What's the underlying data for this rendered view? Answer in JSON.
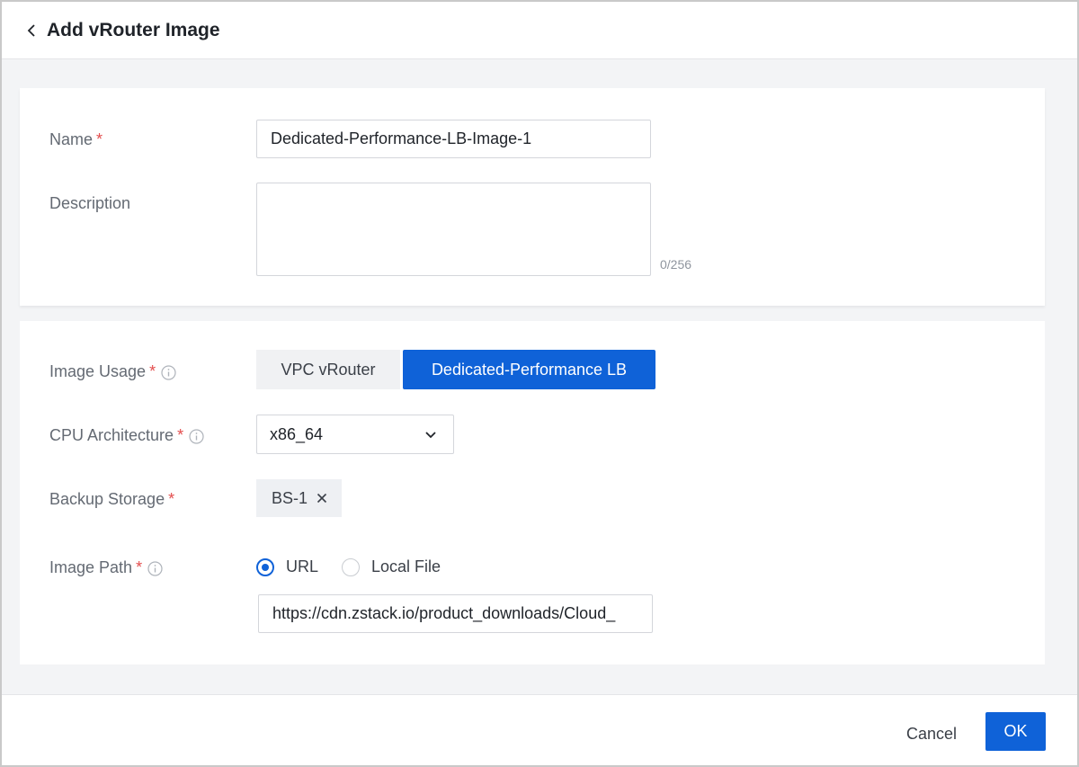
{
  "header": {
    "title": "Add vRouter Image",
    "back_icon": "chevron-left-icon"
  },
  "form": {
    "name": {
      "label": "Name",
      "required_mark": "*",
      "value": "Dedicated-Performance-LB-Image-1"
    },
    "description": {
      "label": "Description",
      "value": "",
      "counter": "0/256"
    },
    "image_usage": {
      "label": "Image Usage",
      "required_mark": "*",
      "options": [
        "VPC vRouter",
        "Dedicated-Performance LB"
      ],
      "selected": "Dedicated-Performance LB"
    },
    "cpu_architecture": {
      "label": "CPU Architecture",
      "required_mark": "*",
      "value": "x86_64"
    },
    "backup_storage": {
      "label": "Backup Storage",
      "required_mark": "*",
      "tag": "BS-1"
    },
    "image_path": {
      "label": "Image Path",
      "required_mark": "*",
      "options": [
        "URL",
        "Local File"
      ],
      "selected": "URL",
      "url_value": "https://cdn.zstack.io/product_downloads/Cloud_"
    }
  },
  "footer": {
    "cancel_label": "Cancel",
    "ok_label": "OK"
  },
  "colors": {
    "primary": "#0f62d8",
    "required": "#e34d4d"
  }
}
